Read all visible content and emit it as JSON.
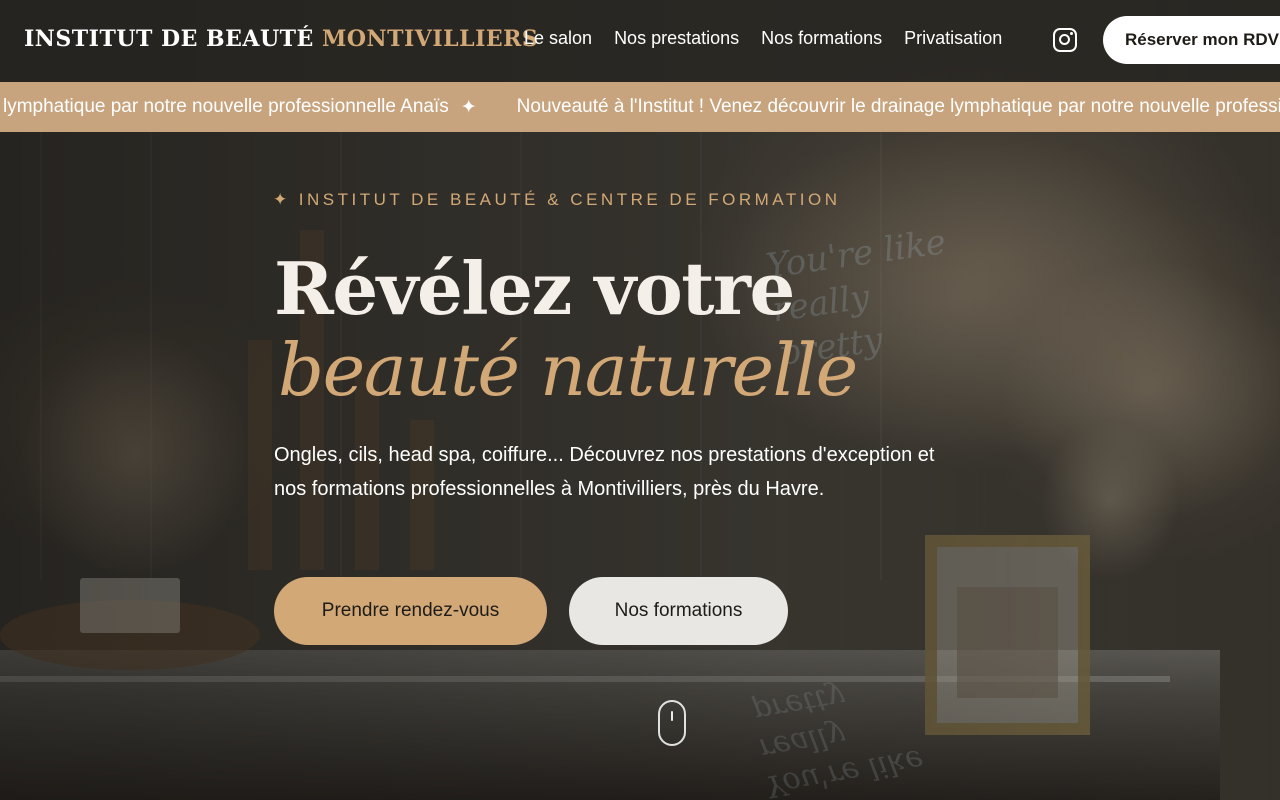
{
  "header": {
    "logo_main": "INSTITUT DE BEAUTÉ",
    "logo_accent": "MONTIVILLIERS",
    "nav": [
      {
        "label": "Le salon"
      },
      {
        "label": "Nos prestations"
      },
      {
        "label": "Nos formations"
      },
      {
        "label": "Privatisation"
      }
    ],
    "instagram_icon": "instagram-icon",
    "book_button": "Réserver mon RDV"
  },
  "marquee": {
    "items": [
      "lymphatique par notre nouvelle professionnelle Anaïs",
      "Nouveauté à l'Institut ! Venez découvrir le drainage lymphatique par notre nouvelle professionnelle Anaïs"
    ],
    "separator": "✦"
  },
  "hero": {
    "eyebrow_icon": "✦",
    "eyebrow": "INSTITUT DE BEAUTÉ & CENTRE DE FORMATION",
    "title_line1": "Révélez votre",
    "title_line2": "beauté naturelle",
    "lead": "Ongles, cils, head spa, coiffure... Découvrez nos prestations d'exception et nos formations professionnelles à Montivilliers, près du Havre.",
    "primary_button": "Prendre rendez-vous",
    "secondary_button": "Nos formations",
    "scroll_icon": "mouse-scroll-icon"
  },
  "colors": {
    "accent": "#d2a876",
    "marquee_bg": "#c8a47e",
    "header_bg": "#26241f",
    "button_light": "#e9e7e4"
  }
}
